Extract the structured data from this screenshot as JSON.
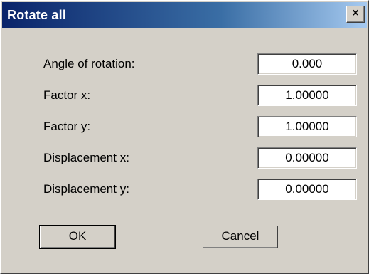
{
  "window": {
    "title": "Rotate all",
    "close_label": "×"
  },
  "fields": [
    {
      "label": "Angle of rotation:",
      "value": "0.000"
    },
    {
      "label": "Factor x:",
      "value": "1.00000"
    },
    {
      "label": "Factor y:",
      "value": "1.00000"
    },
    {
      "label": "Displacement x:",
      "value": "0.00000"
    },
    {
      "label": "Displacement y:",
      "value": "0.00000"
    }
  ],
  "buttons": {
    "ok_label": "OK",
    "cancel_label": "Cancel"
  }
}
